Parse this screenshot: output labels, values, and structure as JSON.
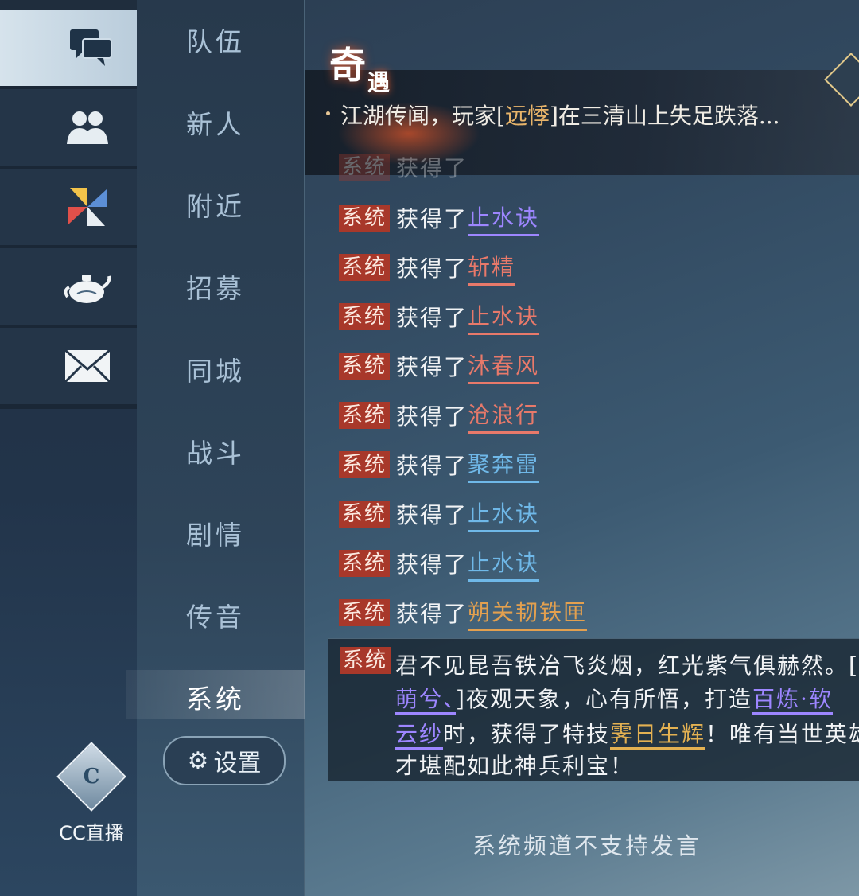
{
  "sidebar": {
    "icons": [
      {
        "name": "chat-bubbles-icon",
        "active": true
      },
      {
        "name": "friends-icon",
        "active": false
      },
      {
        "name": "pinwheel-icon",
        "active": false
      },
      {
        "name": "teapot-icon",
        "active": false
      },
      {
        "name": "mail-icon",
        "active": false
      }
    ],
    "cc_label": "CC直播"
  },
  "channels": {
    "items": [
      "队伍",
      "新人",
      "附近",
      "招募",
      "同城",
      "战斗",
      "剧情",
      "传音",
      "系统"
    ],
    "active": "系统",
    "settings_label": "设置"
  },
  "banner": {
    "title_big": "奇",
    "title_small": "遇",
    "message_prefix": "江湖传闻，玩家[",
    "player_name": "远悸",
    "message_suffix": "]在三清山上失足跌落..."
  },
  "messages": {
    "tag": "系统",
    "verb": "获得了",
    "rows": [
      {
        "item": "止水诀",
        "color": "#9d86ff"
      },
      {
        "item": "斩精",
        "color": "#e8796a"
      },
      {
        "item": "止水诀",
        "color": "#e8796a"
      },
      {
        "item": "沐春风",
        "color": "#e8796a"
      },
      {
        "item": "沧浪行",
        "color": "#e8796a"
      },
      {
        "item": "聚奔雷",
        "color": "#6fb8e8"
      },
      {
        "item": "止水诀",
        "color": "#6fb8e8"
      },
      {
        "item": "止水诀",
        "color": "#6fb8e8"
      },
      {
        "item": "朔关韧铁匣",
        "color": "#e3a04f"
      }
    ]
  },
  "system_message": {
    "line1": "君不见昆吾铁冶飞炎烟，红光紫气俱赫然。[",
    "player": "萌兮、",
    "line2_rest": "]夜观天象，心有所悟，打造",
    "weapon_part1": "百炼·软",
    "weapon_part2": "云纱",
    "line3_rest": "时，获得了特技",
    "skill": "霁日生辉",
    "line3_end": "！唯有当世英雄",
    "line4": "才堪配如此神兵利宝！"
  },
  "footer_text": "系统频道不支持发言",
  "colors": {
    "tag_bg": "#a8382a",
    "accent_gold": "#e3b152",
    "accent_violet": "#9d86ff"
  }
}
